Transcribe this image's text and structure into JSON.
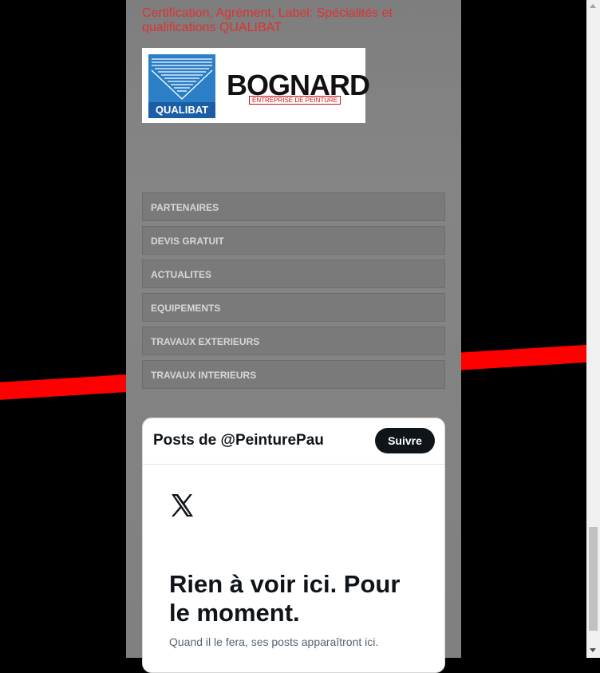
{
  "certification": {
    "title": "Certification, Agrément, Label: Spécialités et qualifications QUALIBAT"
  },
  "logo": {
    "qualibat": "QUALIBAT",
    "company": "BOGNARD",
    "company_sub": "ENTREPRISE DE PEINTURE"
  },
  "menu": {
    "items": [
      {
        "label": "PARTENAIRES"
      },
      {
        "label": "DEVIS GRATUIT"
      },
      {
        "label": "ACTUALITES"
      },
      {
        "label": "EQUIPEMENTS"
      },
      {
        "label": "TRAVAUX EXTERIEURS"
      },
      {
        "label": "TRAVAUX INTERIEURS"
      }
    ]
  },
  "twitter": {
    "title": "Posts de @PeinturePau",
    "follow_label": "Suivre",
    "empty_title": "Rien à voir ici. Pour le moment.",
    "empty_sub": "Quand il le fera, ses posts apparaîtront ici."
  },
  "colors": {
    "accent_red": "#ff0000",
    "cert_red": "#e03030",
    "background": "#000000"
  }
}
